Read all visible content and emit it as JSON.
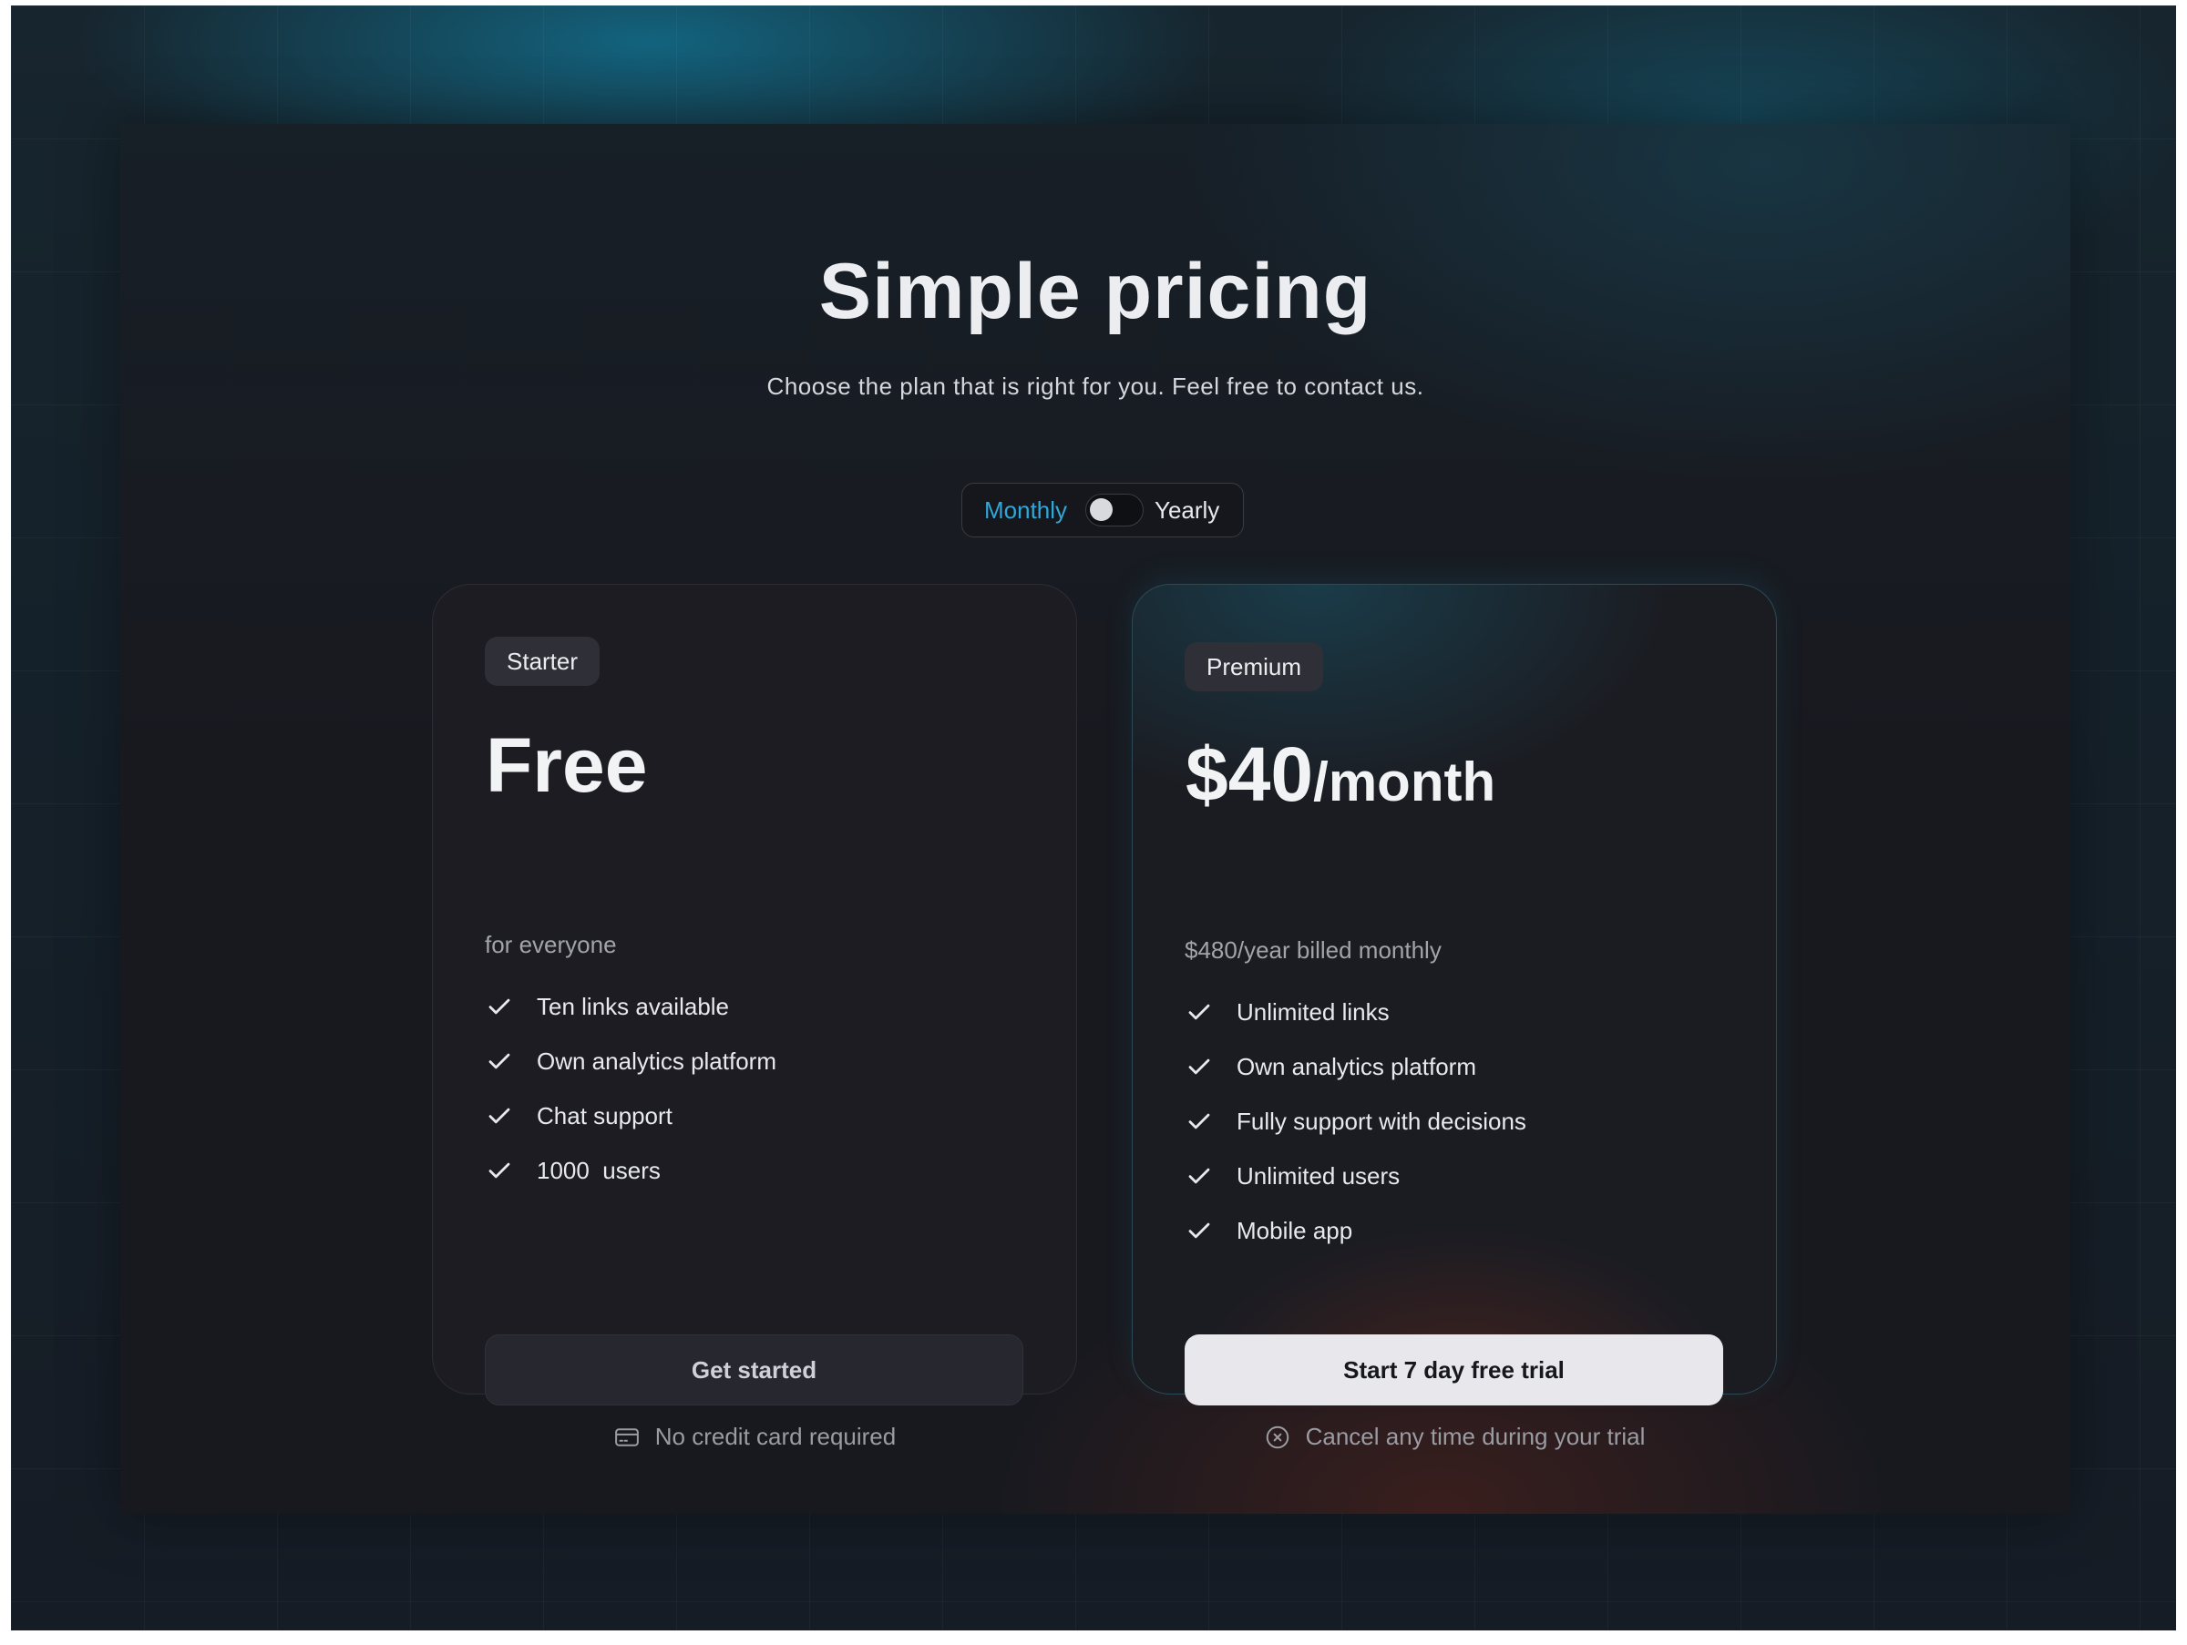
{
  "header": {
    "title": "Simple pricing",
    "subtitle": "Choose the plan that is right for you. Feel free to contact us."
  },
  "billing_toggle": {
    "monthly_label": "Monthly",
    "yearly_label": "Yearly",
    "selected": "Monthly"
  },
  "plans": [
    {
      "badge": "Starter",
      "price": "Free",
      "price_suffix": "",
      "price_sub": "for everyone",
      "features": [
        "Ten links available",
        "Own analytics platform",
        "Chat support",
        "1000  users"
      ],
      "cta": "Get started",
      "note": "No credit card required",
      "note_icon": "credit-card-icon"
    },
    {
      "badge": "Premium",
      "price": "$40",
      "price_suffix": "/month",
      "price_sub": "$480/year billed monthly",
      "features": [
        "Unlimited links",
        "Own analytics platform",
        "Fully support with decisions",
        "Unlimited users",
        "Mobile app"
      ],
      "cta": "Start 7 day free trial",
      "note": "Cancel any time during your trial",
      "note_icon": "x-circle-icon"
    }
  ],
  "colors": {
    "accent": "#2fa7d8",
    "background": "#18191f",
    "card": "#1c1c22",
    "primary_button": "#e7e7ec"
  }
}
